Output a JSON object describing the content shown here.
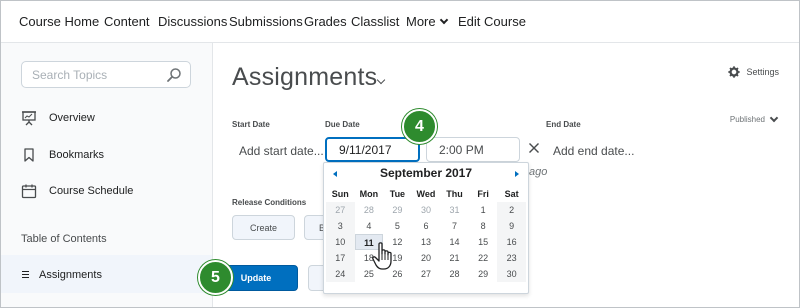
{
  "nav": {
    "items": [
      {
        "label": "Course Home"
      },
      {
        "label": "Content"
      },
      {
        "label": "Discussions"
      },
      {
        "label": "Submissions"
      },
      {
        "label": "Grades"
      },
      {
        "label": "Classlist"
      },
      {
        "label": "More"
      },
      {
        "label": "Edit Course"
      }
    ]
  },
  "sidebar": {
    "search_placeholder": "Search Topics",
    "items": [
      {
        "label": "Overview",
        "icon": "presentation-board-icon"
      },
      {
        "label": "Bookmarks",
        "icon": "bookmark-icon"
      },
      {
        "label": "Course Schedule",
        "icon": "calendar-icon"
      }
    ],
    "toc_label": "Table of Contents",
    "toc_items": [
      {
        "label": "Assignments"
      }
    ]
  },
  "main": {
    "title": "Assignments",
    "settings_label": "Settings",
    "published_label": "Published",
    "start_date": {
      "label": "Start Date",
      "placeholder": "Add start date..."
    },
    "due_date": {
      "label": "Due Date",
      "value": "9/11/2017",
      "time": "2:00 PM",
      "ago_suffix": "ago"
    },
    "end_date": {
      "label": "End Date",
      "placeholder": "Add end date..."
    },
    "release_conditions": {
      "label": "Release Conditions",
      "create_label": "Create",
      "second_label": "B"
    },
    "update_label": "Update"
  },
  "calendar": {
    "month_label": "September 2017",
    "weekdays": [
      "Sun",
      "Mon",
      "Tue",
      "Wed",
      "Thu",
      "Fri",
      "Sat"
    ],
    "weeks": [
      [
        {
          "d": "27",
          "m": true
        },
        {
          "d": "28",
          "m": true
        },
        {
          "d": "29",
          "m": true
        },
        {
          "d": "30",
          "m": true
        },
        {
          "d": "31",
          "m": true
        },
        {
          "d": "1"
        },
        {
          "d": "2"
        }
      ],
      [
        {
          "d": "3"
        },
        {
          "d": "4"
        },
        {
          "d": "5"
        },
        {
          "d": "6"
        },
        {
          "d": "7"
        },
        {
          "d": "8"
        },
        {
          "d": "9"
        }
      ],
      [
        {
          "d": "10"
        },
        {
          "d": "11",
          "sel": true
        },
        {
          "d": "12"
        },
        {
          "d": "13"
        },
        {
          "d": "14"
        },
        {
          "d": "15"
        },
        {
          "d": "16"
        }
      ],
      [
        {
          "d": "17"
        },
        {
          "d": "18"
        },
        {
          "d": "19"
        },
        {
          "d": "20"
        },
        {
          "d": "21"
        },
        {
          "d": "22"
        },
        {
          "d": "23"
        }
      ],
      [
        {
          "d": "24"
        },
        {
          "d": "25"
        },
        {
          "d": "26"
        },
        {
          "d": "27"
        },
        {
          "d": "28"
        },
        {
          "d": "29"
        },
        {
          "d": "30"
        }
      ]
    ]
  },
  "callouts": {
    "step4": "4",
    "step5": "5"
  },
  "colors": {
    "accent": "#006fbf",
    "callout": "#2e8b2e"
  }
}
